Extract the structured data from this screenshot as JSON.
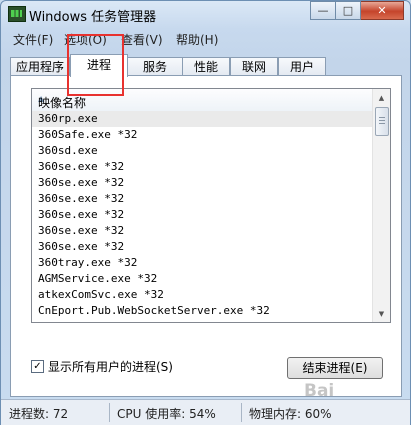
{
  "window": {
    "title": "Windows 任务管理器",
    "buttons": {
      "minimize": "—",
      "maximize": "□",
      "close": "✕"
    }
  },
  "menu": [
    "文件(F)",
    "选项(O)",
    "查看(V)",
    "帮助(H)"
  ],
  "tabs": [
    "应用程序",
    "进程",
    "服务",
    "性能",
    "联网",
    "用户"
  ],
  "active_tab": "进程",
  "list": {
    "column_header": "映像名称",
    "rows": [
      "360rp.exe",
      "360Safe.exe *32",
      "360sd.exe",
      "360se.exe *32",
      "360se.exe *32",
      "360se.exe *32",
      "360se.exe *32",
      "360se.exe *32",
      "360se.exe *32",
      "360tray.exe *32",
      "AGMService.exe *32",
      "atkexComSvc.exe *32",
      "CnEport.Pub.WebSocketServer.exe *32"
    ]
  },
  "show_all_users": {
    "label": "显示所有用户的进程(S)",
    "checked": true,
    "mark": "✓"
  },
  "end_process_button": "结束进程(E)",
  "statusbar": {
    "process_count": "进程数: 72",
    "cpu_usage": "CPU 使用率: 54%",
    "physical_memory": "物理内存: 60%"
  },
  "watermark": "Bai"
}
